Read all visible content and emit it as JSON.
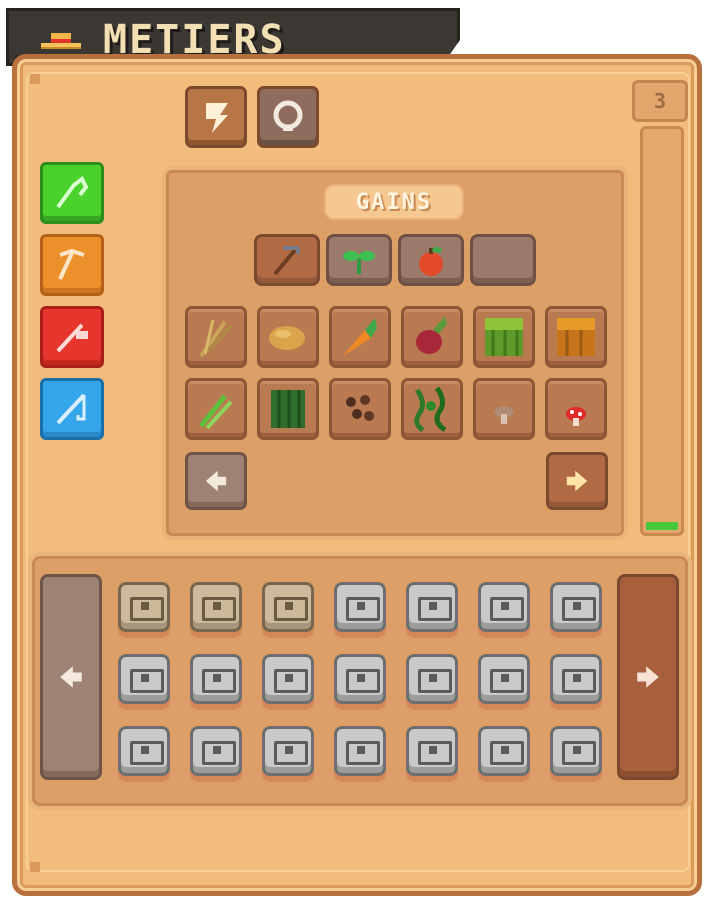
{
  "title": "METIERS",
  "title_icon": "straw-hat-icon",
  "top_toggles": [
    {
      "icon": "lightning-icon",
      "state": "active"
    },
    {
      "icon": "ring-icon",
      "state": "inactive"
    }
  ],
  "level": "3",
  "xp_gauge_fraction": 0.02,
  "job_tabs": [
    {
      "icon": "sickle-icon",
      "color": "#4ad12c"
    },
    {
      "icon": "pickaxe-icon",
      "color": "#ec902c"
    },
    {
      "icon": "hammer-icon",
      "color": "#e5352d"
    },
    {
      "icon": "fishing-rod-icon",
      "color": "#36a6ea"
    }
  ],
  "gains": {
    "label": "GAINS",
    "filters": [
      "hoe-icon",
      "sprout-icon",
      "apple-icon",
      "empty"
    ],
    "items": [
      "wheat-icon",
      "potato-icon",
      "carrot-icon",
      "beetroot-icon",
      "melon-icon",
      "pumpkin-icon",
      "sugar-cane-icon",
      "cactus-icon",
      "cocoa-beans-icon",
      "vines-icon",
      "brown-mushroom-icon",
      "red-mushroom-icon"
    ]
  },
  "inventory": {
    "rows": 3,
    "cols": 7,
    "gold_slots": [
      0,
      1,
      2
    ]
  }
}
